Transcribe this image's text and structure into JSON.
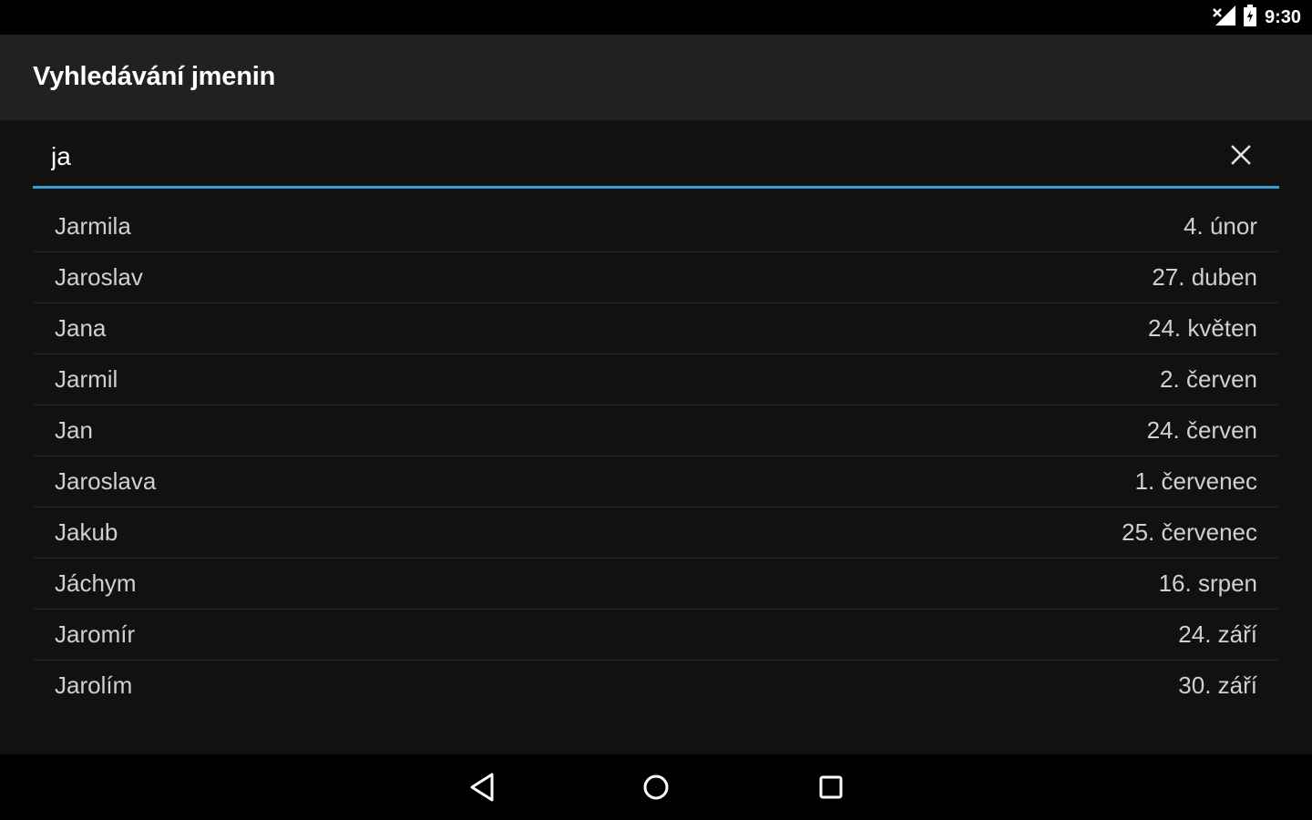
{
  "status_bar": {
    "time": "9:30",
    "icons": [
      "signal-icon",
      "battery-icon"
    ]
  },
  "app": {
    "title": "Vyhledávání jmenin"
  },
  "search": {
    "value": "ja",
    "clear_icon": "close-icon",
    "accent_color": "#33a0d8"
  },
  "results": [
    {
      "name": "Jarmila",
      "date": "4. únor"
    },
    {
      "name": "Jaroslav",
      "date": "27. duben"
    },
    {
      "name": "Jana",
      "date": "24. květen"
    },
    {
      "name": "Jarmil",
      "date": "2. červen"
    },
    {
      "name": "Jan",
      "date": "24. červen"
    },
    {
      "name": "Jaroslava",
      "date": "1. červenec"
    },
    {
      "name": "Jakub",
      "date": "25. červenec"
    },
    {
      "name": "Jáchym",
      "date": "16. srpen"
    },
    {
      "name": "Jaromír",
      "date": "24. září"
    },
    {
      "name": "Jarolím",
      "date": "30. září"
    }
  ],
  "nav_bar": {
    "buttons": [
      "back-icon",
      "home-icon",
      "recents-icon"
    ]
  }
}
